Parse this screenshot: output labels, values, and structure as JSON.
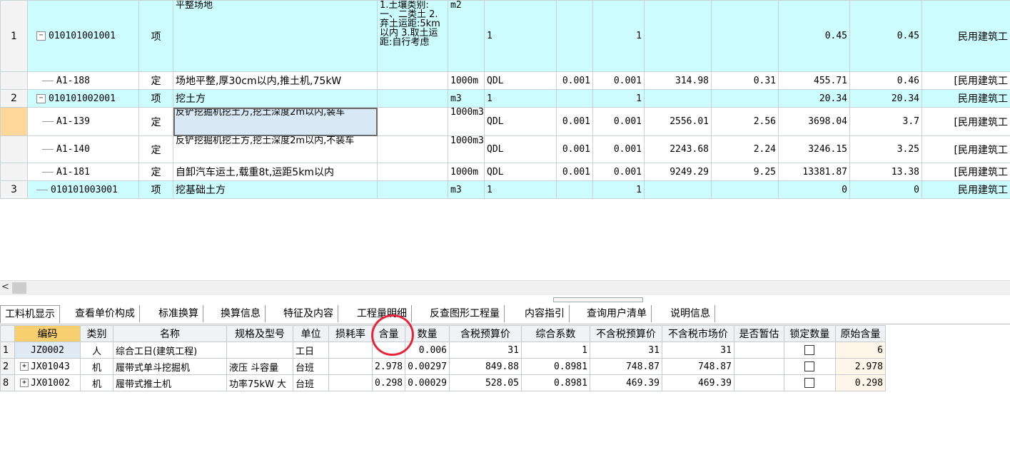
{
  "upper_rows": [
    {
      "type": "qd",
      "rn": "1",
      "expander": "−",
      "code": "010101001001",
      "cat": "项",
      "name": "平整场地",
      "feature": "1.土壤类别:一、二类土\n2.弃土运距:5km 以内\n3.取土运距:自行考虑",
      "unit": "m2",
      "expr": "1",
      "c7": "",
      "c8": "1",
      "c9": "",
      "c10": "",
      "c11": "0.45",
      "c12": "0.45",
      "c13": "民用建筑工"
    },
    {
      "type": "de",
      "rn": "",
      "code": "A1-188",
      "cat": "定",
      "name": "场地平整,厚30cm以内,推土机,75kW",
      "feature": "",
      "unit": "1000m",
      "expr": "QDL",
      "c7": "0.001",
      "c8": "0.001",
      "c9": "314.98",
      "c10": "0.31",
      "c11": "455.71",
      "c12": "0.46",
      "c13": "[民用建筑工"
    },
    {
      "type": "qd",
      "rn": "2",
      "expander": "−",
      "code": "010101002001",
      "cat": "项",
      "name": "挖土方",
      "feature": "",
      "unit": "m3",
      "expr": "1",
      "c7": "",
      "c8": "1",
      "c9": "",
      "c10": "",
      "c11": "20.34",
      "c12": "20.34",
      "c13": "民用建筑工"
    },
    {
      "type": "de",
      "rn": "",
      "code": "A1-139",
      "cat": "定",
      "name": "反铲挖掘机挖土方,挖土深度2m以内,装车",
      "feature": "",
      "unit": "1000m3",
      "expr": "QDL",
      "c7": "0.001",
      "c8": "0.001",
      "c9": "2556.01",
      "c10": "2.56",
      "c11": "3698.04",
      "c12": "3.7",
      "c13": "[民用建筑工"
    },
    {
      "type": "de",
      "rn": "",
      "code": "A1-140",
      "cat": "定",
      "name": "反铲挖掘机挖土方,挖土深度2m以内,不装车",
      "feature": "",
      "unit": "1000m3",
      "expr": "QDL",
      "c7": "0.001",
      "c8": "0.001",
      "c9": "2243.68",
      "c10": "2.24",
      "c11": "3246.15",
      "c12": "3.25",
      "c13": "[民用建筑工"
    },
    {
      "type": "de",
      "rn": "",
      "code": "A1-181",
      "cat": "定",
      "name": "自卸汽车运土,载重8t,运距5km以内",
      "feature": "",
      "unit": "1000m",
      "expr": "QDL",
      "c7": "0.001",
      "c8": "0.001",
      "c9": "9249.29",
      "c10": "9.25",
      "c11": "13381.87",
      "c12": "13.38",
      "c13": "[民用建筑工"
    },
    {
      "type": "qd",
      "rn": "3",
      "expander": "",
      "code": "010101003001",
      "cat": "项",
      "name": "挖基础土方",
      "feature": "",
      "unit": "m3",
      "expr": "1",
      "c7": "",
      "c8": "1",
      "c9": "",
      "c10": "",
      "c11": "0",
      "c12": "0",
      "c13": "民用建筑工"
    }
  ],
  "scrollbar": {
    "left_arrow": "<"
  },
  "tabs": [
    "工料机显示",
    "查看单价构成",
    "标准换算",
    "换算信息",
    "特征及内容",
    "工程量明细",
    "反查图形工程量",
    "内容指引",
    "查询用户清单",
    "说明信息"
  ],
  "lower": {
    "headers": [
      "",
      "编码",
      "类别",
      "名称",
      "规格及型号",
      "单位",
      "损耗率",
      "含量",
      "数量",
      "含税预算价",
      "综合系数",
      "不含税预算价",
      "不含税市场价",
      "是否暂估",
      "锁定数量",
      "原始含量"
    ],
    "rows": [
      {
        "rn": "1",
        "expander": "",
        "code": "JZ0002",
        "cat": "人",
        "name": "综合工日(建筑工程)",
        "spec": "",
        "unit": "工日",
        "loss": "",
        "qty_rate": "",
        "qty": "0.006",
        "price_tax": "31",
        "coef": "1",
        "price_notax": "31",
        "market_notax": "31",
        "est": "",
        "orig": "6"
      },
      {
        "rn": "2",
        "expander": "+",
        "code": "JX01043",
        "cat": "机",
        "name": "履带式单斗挖掘机",
        "spec": "液压 斗容量",
        "unit": "台班",
        "loss": "",
        "qty_rate": "2.978",
        "qty": "0.00297",
        "price_tax": "849.88",
        "coef": "0.8981",
        "price_notax": "748.87",
        "market_notax": "748.87",
        "est": "",
        "orig": "2.978"
      },
      {
        "rn": "8",
        "expander": "+",
        "code": "JX01002",
        "cat": "机",
        "name": "履带式推土机",
        "spec": "功率75kW 大",
        "unit": "台班",
        "loss": "",
        "qty_rate": "0.298",
        "qty": "0.00029",
        "price_tax": "528.05",
        "coef": "0.8981",
        "price_notax": "469.39",
        "market_notax": "469.39",
        "est": "",
        "orig": "0.298"
      }
    ]
  },
  "colors": {
    "qd_row": "#cdfcff",
    "header_highlight": "#f8cf6e",
    "annotation_circle": "#e8243b"
  }
}
